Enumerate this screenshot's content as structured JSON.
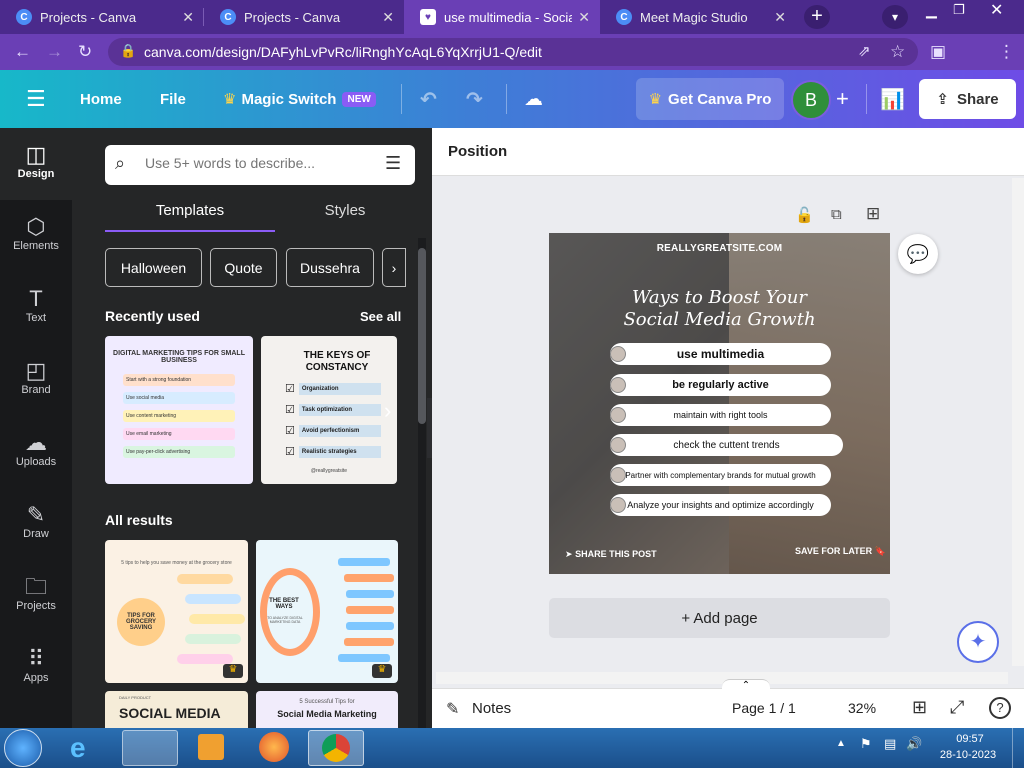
{
  "browser": {
    "tabs": [
      {
        "title": "Projects - Canva"
      },
      {
        "title": "Projects - Canva"
      },
      {
        "title": "use multimedia - Social M"
      },
      {
        "title": "Meet Magic Studio"
      }
    ],
    "url": "canva.com/design/DAFyhLvPvRc/liRnghYcAqL6YqXrrjU1-Q/edit"
  },
  "header": {
    "home": "Home",
    "file": "File",
    "magic_switch": "Magic Switch",
    "new_badge": "NEW",
    "get_pro": "Get Canva Pro",
    "avatar_initial": "B",
    "share": "Share"
  },
  "rail": [
    {
      "label": "Design",
      "icon": "design-icon"
    },
    {
      "label": "Elements",
      "icon": "elements-icon"
    },
    {
      "label": "Text",
      "icon": "text-icon"
    },
    {
      "label": "Brand",
      "icon": "brand-icon"
    },
    {
      "label": "Uploads",
      "icon": "uploads-icon"
    },
    {
      "label": "Draw",
      "icon": "draw-icon"
    },
    {
      "label": "Projects",
      "icon": "projects-icon"
    },
    {
      "label": "Apps",
      "icon": "apps-icon"
    }
  ],
  "panel": {
    "search_placeholder": "Use 5+ words to describe...",
    "tabs": [
      "Templates",
      "Styles"
    ],
    "chips": [
      "Halloween",
      "Quote",
      "Dussehra"
    ],
    "recently_used": "Recently used",
    "see_all": "See all",
    "all_results": "All results",
    "recent": [
      {
        "title": "DIGITAL MARKETING TIPS FOR SMALL BUSINESS",
        "items": [
          "Start with a strong foundation",
          "Use social media",
          "Use content marketing",
          "Use email marketing",
          "Use pay-per-click advertising"
        ]
      },
      {
        "title": "THE KEYS OF CONSTANCY",
        "items": [
          "Organization",
          "Task optimization",
          "Avoid perfectionism",
          "Realistic strategies"
        ],
        "handle": "@reallygreatsite"
      }
    ],
    "results": [
      {
        "title": "TIPS FOR GROCERY SAVING",
        "subtitle": "5 tips to help you save money at the grocery store"
      },
      {
        "title": "THE BEST WAYS",
        "subtitle": "TO ANALYZE DIGITAL MARKETING DATA"
      },
      {
        "title": "SOCIAL MEDIA",
        "subtitle": "DAILY PRODUCT"
      },
      {
        "title": "Social Media Marketing",
        "subtitle": "5 Successful Tips for"
      }
    ]
  },
  "editor": {
    "position": "Position",
    "add_page": "+ Add page",
    "notes": "Notes",
    "page": "Page 1 / 1",
    "zoom": "32%"
  },
  "design": {
    "site": "REALLYGREATSITE.COM",
    "title_line1": "Ways to Boost Your",
    "title_line2": "Social Media Growth",
    "items": [
      "use  multimedia",
      "be regularly active",
      "maintain with right tools",
      "check the cuttent trends",
      "Partner with complementary brands for mutual growth",
      "Analyze your insights and optimize accordingly"
    ],
    "share_post": "SHARE THIS POST",
    "save_later": "SAVE FOR LATER"
  },
  "taskbar": {
    "time": "09:57",
    "date": "28-10-2023"
  }
}
